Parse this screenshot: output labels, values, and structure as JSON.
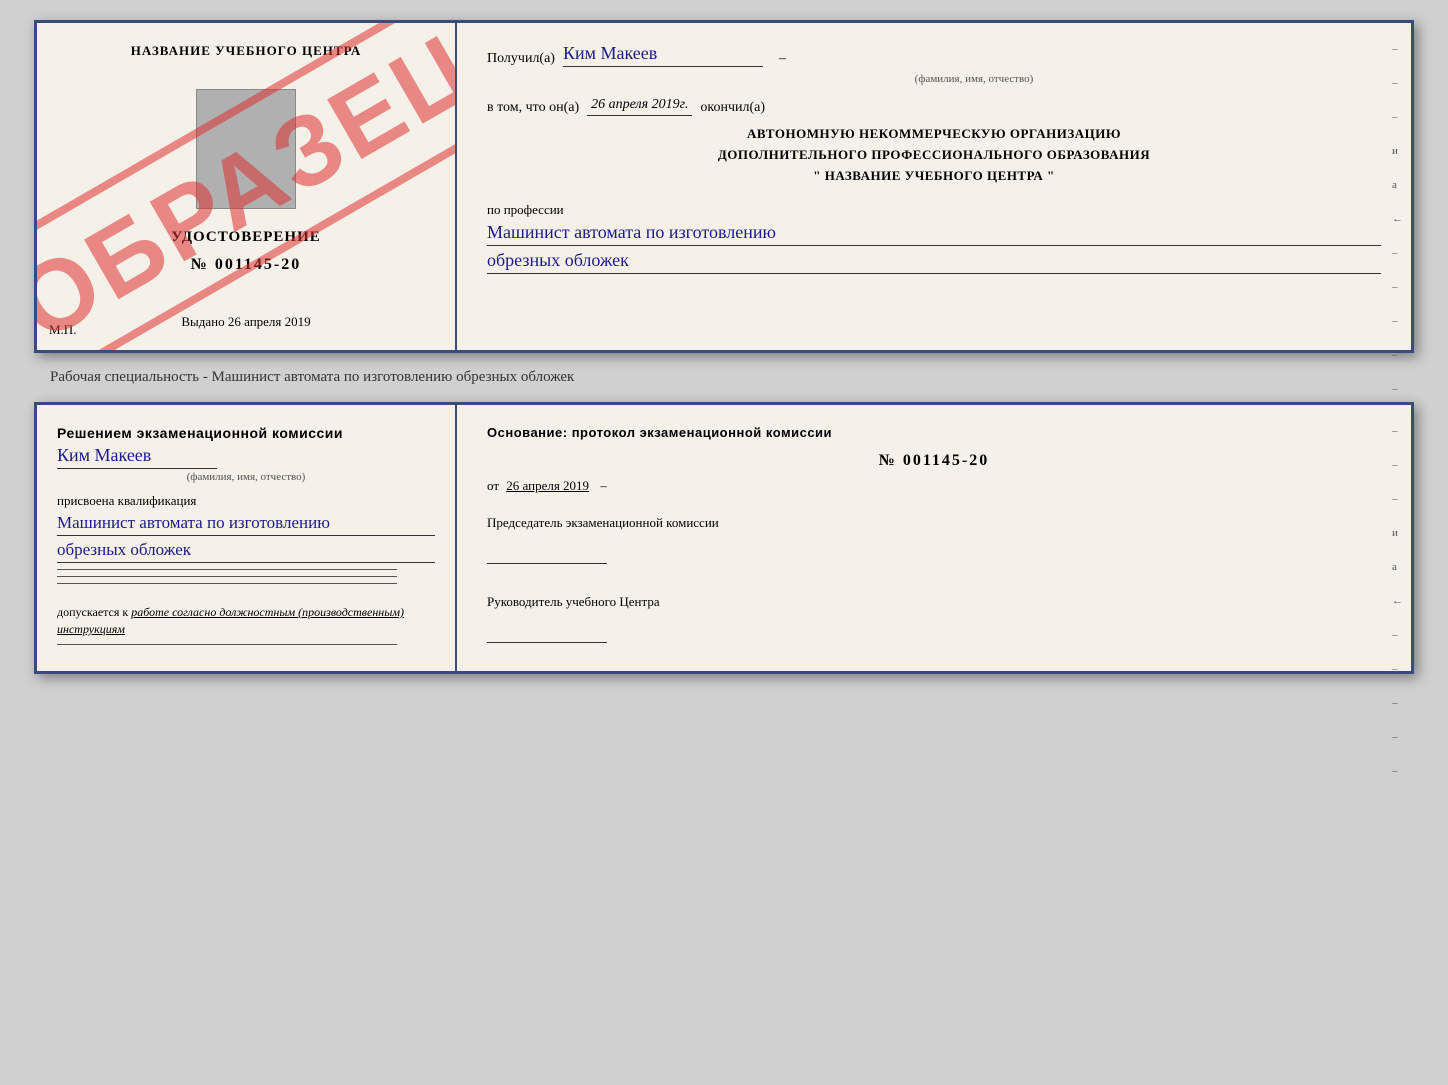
{
  "top_card": {
    "left": {
      "school_name": "НАЗВАНИЕ УЧЕБНОГО ЦЕНТРА",
      "cert_title": "УДОСТОВЕРЕНИЕ",
      "cert_number": "№ 001145-20",
      "issued_label": "Выдано",
      "issued_date": "26 апреля 2019",
      "mp_label": "М.П.",
      "watermark": "ОБРАЗЕЦ"
    },
    "right": {
      "recipient_label": "Получил(а)",
      "recipient_name": "Ким Макеев",
      "fio_label": "(фамилия, имя, отчество)",
      "date_intro": "в том, что он(а)",
      "date_value": "26 апреля 2019г.",
      "date_outro": "окончил(а)",
      "org_line1": "АВТОНОМНУЮ НЕКОММЕРЧЕСКУЮ ОРГАНИЗАЦИЮ",
      "org_line2": "ДОПОЛНИТЕЛЬНОГО ПРОФЕССИОНАЛЬНОГО ОБРАЗОВАНИЯ",
      "org_line3": "\" НАЗВАНИЕ УЧЕБНОГО ЦЕНТРА \"",
      "profession_label": "по профессии",
      "profession_line1": "Машинист автомата по изготовлению",
      "profession_line2": "обрезных обложек",
      "side_letters": [
        "–",
        "–",
        "–",
        "и",
        "а",
        "←",
        "–",
        "–",
        "–",
        "–",
        "–"
      ]
    }
  },
  "between_text": "Рабочая специальность - Машинист автомата по изготовлению обрезных обложек",
  "bottom_card": {
    "left": {
      "decision_text": "Решением экзаменационной комиссии",
      "person_name": "Ким Макеев",
      "fio_label": "(фамилия, имя, отчество)",
      "qual_assigned": "присвоена квалификация",
      "qual_line1": "Машинист автомата по изготовлению",
      "qual_line2": "обрезных обложек",
      "допускается_label": "допускается к",
      "допускается_value": "работе согласно должностным (производственным) инструкциям"
    },
    "right": {
      "basis_text": "Основание: протокол экзаменационной комиссии",
      "protocol_number": "№ 001145-20",
      "protocol_date_prefix": "от",
      "protocol_date": "26 апреля 2019",
      "chairman_label": "Председатель экзаменационной комиссии",
      "director_label": "Руководитель учебного Центра",
      "side_letters": [
        "–",
        "–",
        "–",
        "и",
        "а",
        "←",
        "–",
        "–",
        "–",
        "–",
        "–"
      ]
    }
  }
}
